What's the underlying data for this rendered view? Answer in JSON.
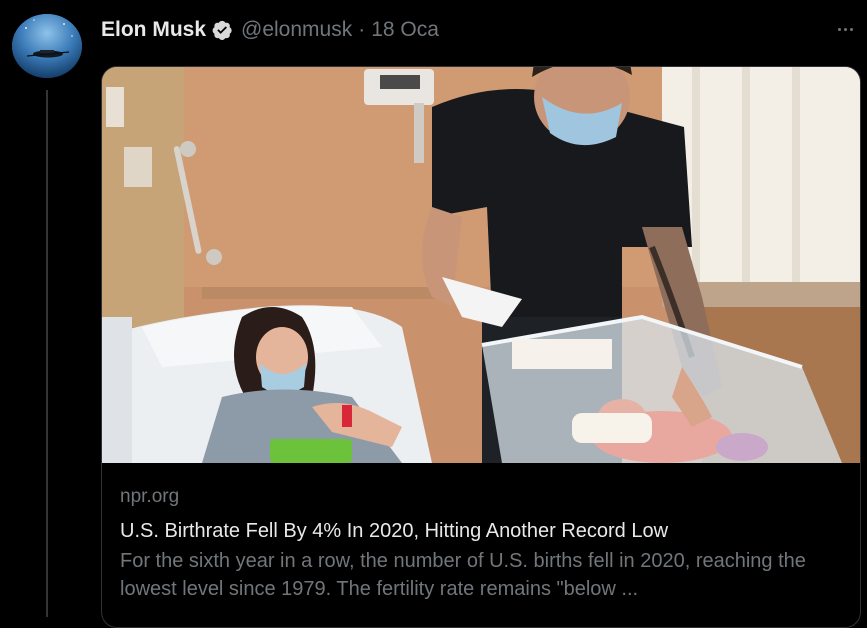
{
  "tweet": {
    "author_name": "Elon Musk",
    "handle": "@elonmusk",
    "separator": "·",
    "date": "18 Oca",
    "verified": true,
    "icons": {
      "verified": "verified-badge-icon",
      "more": "more-options-icon"
    }
  },
  "link_card": {
    "domain": "npr.org",
    "title": "U.S. Birthrate Fell By 4% In 2020, Hitting Another Record Low",
    "description": "For the sixth year in a row, the number of U.S. births fell in 2020, reaching the lowest level since 1979. The fertility rate remains \"below ..."
  },
  "colors": {
    "background": "#000000",
    "primary_text": "#e7e9ea",
    "secondary_text": "#71767b",
    "border": "#2f3336",
    "verified": "#d9d9d9"
  }
}
